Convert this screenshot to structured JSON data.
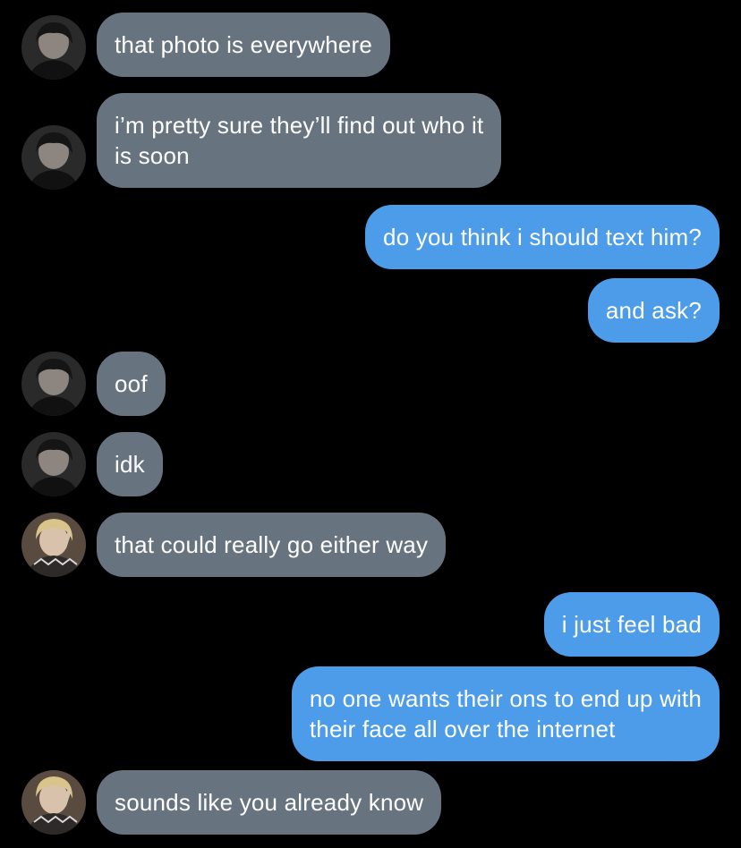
{
  "colors": {
    "background": "#000000",
    "incoming_bubble": "#677480",
    "outgoing_bubble": "#4c9ce9",
    "text": "#ffffff"
  },
  "messages": [
    {
      "id": 1,
      "direction": "incoming",
      "avatar": "dark-haired-avatar-icon",
      "text": "that photo is everywhere"
    },
    {
      "id": 2,
      "direction": "incoming",
      "avatar": "dark-haired-avatar-icon",
      "text": "i’m pretty sure they’ll find out who it\nis soon"
    },
    {
      "id": 3,
      "direction": "outgoing",
      "text": "do you think i should text him?"
    },
    {
      "id": 4,
      "direction": "outgoing",
      "text": "and ask?"
    },
    {
      "id": 5,
      "direction": "incoming",
      "avatar": "dark-haired-avatar-icon",
      "text": "oof"
    },
    {
      "id": 6,
      "direction": "incoming",
      "avatar": "dark-haired-avatar-icon",
      "text": "idk"
    },
    {
      "id": 7,
      "direction": "incoming",
      "avatar": "blond-haired-avatar-icon",
      "text": "that could really go either way"
    },
    {
      "id": 8,
      "direction": "outgoing",
      "text": "i just feel bad"
    },
    {
      "id": 9,
      "direction": "outgoing",
      "text": "no one wants their ons to end up with\ntheir face all over the internet"
    },
    {
      "id": 10,
      "direction": "incoming",
      "avatar": "blond-haired-avatar-icon",
      "text": "sounds like you already know"
    }
  ]
}
